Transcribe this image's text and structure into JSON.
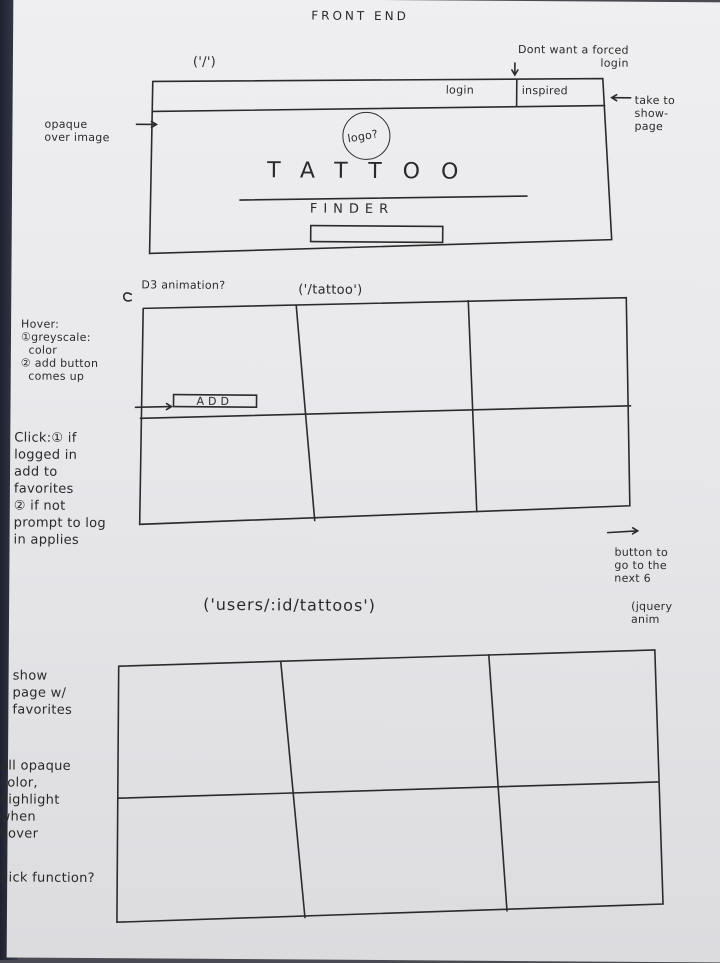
{
  "header": {
    "title": "FRONT END"
  },
  "landing": {
    "route": "('/')",
    "nav_login": "login",
    "nav_inspired": "inspired",
    "note_forced_login": "Dont want a forced\nlogin",
    "note_showpage": "take to\nshow-\npage",
    "note_opaque": "opaque\nover image",
    "logo": "logo?",
    "brand_word1": "TATTOO",
    "brand_word2": "FINDER"
  },
  "tattoo_grid": {
    "note_d3": "D3 animation?",
    "route": "('/tattoo')",
    "hover_note": "Hover:\n①greyscale:\n  color\n② add button\n  comes up",
    "add_button": "ADD",
    "click_note": "Click:① if\nlogged in\nadd to\nfavorites\n② if not\nprompt to log\nin applies",
    "next_note": "button to\ngo to the\nnext 6",
    "jquery_note": "(jquery\nanim"
  },
  "favorites_grid": {
    "route": "('users/:id/tattoos')",
    "show_note": "show\npage w/\nfavorites",
    "opaque_note": "all opaque\ncolor,\nhighlight\nwhen\nhover",
    "click_note": "click function?"
  }
}
